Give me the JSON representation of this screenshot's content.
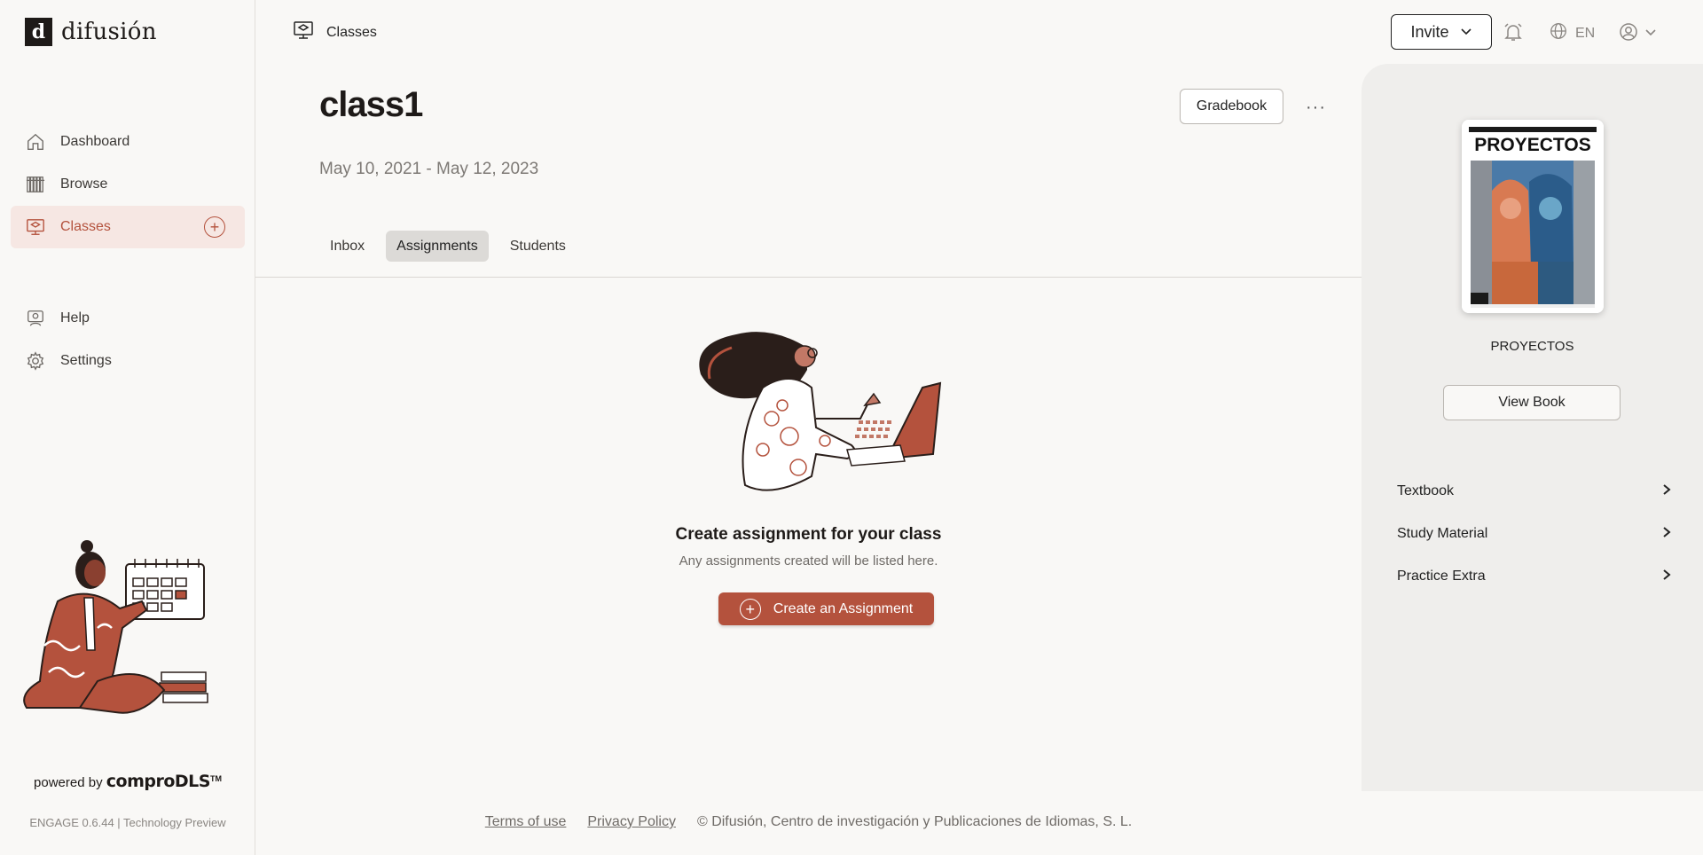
{
  "brand": {
    "logo_letter": "d",
    "name": "difusión"
  },
  "sidebar": {
    "items": [
      {
        "label": "Dashboard",
        "icon": "home-icon"
      },
      {
        "label": "Browse",
        "icon": "books-icon"
      },
      {
        "label": "Classes",
        "icon": "classroom-icon",
        "active": true
      }
    ],
    "items2": [
      {
        "label": "Help",
        "icon": "help-icon"
      },
      {
        "label": "Settings",
        "icon": "gear-icon"
      }
    ],
    "powered_prefix": "powered by",
    "powered_brand": "comproDLS",
    "powered_tm": "TM",
    "version": "ENGAGE 0.6.44 | Technology Preview"
  },
  "header": {
    "breadcrumb": "Classes",
    "invite_label": "Invite",
    "lang": "EN"
  },
  "main": {
    "title": "class1",
    "dates": "May 10, 2021 - May 12, 2023",
    "gradebook_label": "Gradebook",
    "more_label": "···",
    "tabs": [
      {
        "label": "Inbox",
        "active": false
      },
      {
        "label": "Assignments",
        "active": true
      },
      {
        "label": "Students",
        "active": false
      }
    ],
    "empty_title": "Create assignment for your class",
    "empty_sub": "Any assignments created will be listed here.",
    "create_label": "Create an Assignment"
  },
  "right_panel": {
    "cover_title": "PROYECTOS",
    "book_name": "PROYECTOS",
    "view_book_label": "View Book",
    "items": [
      {
        "label": "Textbook"
      },
      {
        "label": "Study Material"
      },
      {
        "label": "Practice Extra"
      }
    ]
  },
  "footer": {
    "terms": "Terms of use",
    "privacy": "Privacy Policy",
    "copyright": "© Difusión, Centro de investigación y Publicaciones de Idiomas, S. L."
  },
  "colors": {
    "accent": "#b4523d",
    "accent_bg": "#f6e7e3",
    "page_bg": "#f9f8f6",
    "panel_bg": "#efeeec"
  }
}
